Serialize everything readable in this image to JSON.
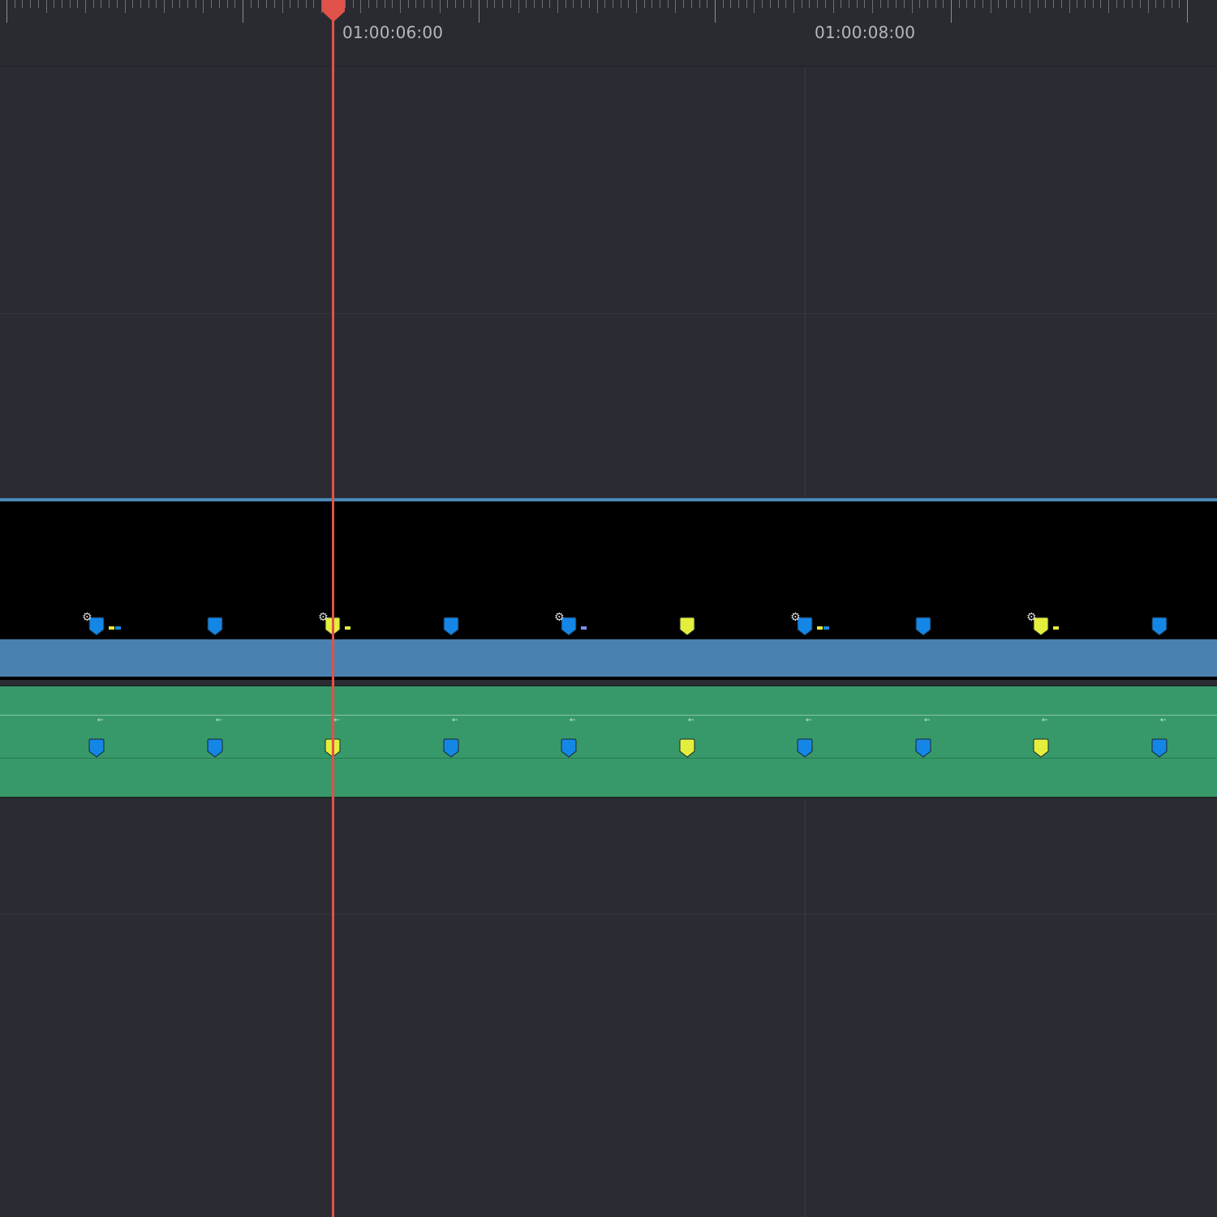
{
  "ruler": {
    "timecodes": [
      "01:00:06:00",
      "01:00:08:00"
    ]
  },
  "colors": {
    "background": "#2b2c33",
    "playhead": "#e0524a",
    "video_clip": "#000000",
    "video_clip_bar": "#4a81b0",
    "audio_clip": "#37996a",
    "marker_blue": "#1486e6",
    "marker_yellow": "#e4ee3c"
  },
  "timeline": {
    "video_markers": [
      "blue",
      "blue",
      "yellow",
      "blue",
      "blue",
      "yellow",
      "blue",
      "blue",
      "yellow",
      "blue"
    ],
    "audio_markers": [
      "blue",
      "blue",
      "yellow",
      "blue",
      "blue",
      "yellow",
      "blue",
      "blue",
      "yellow",
      "blue"
    ]
  }
}
